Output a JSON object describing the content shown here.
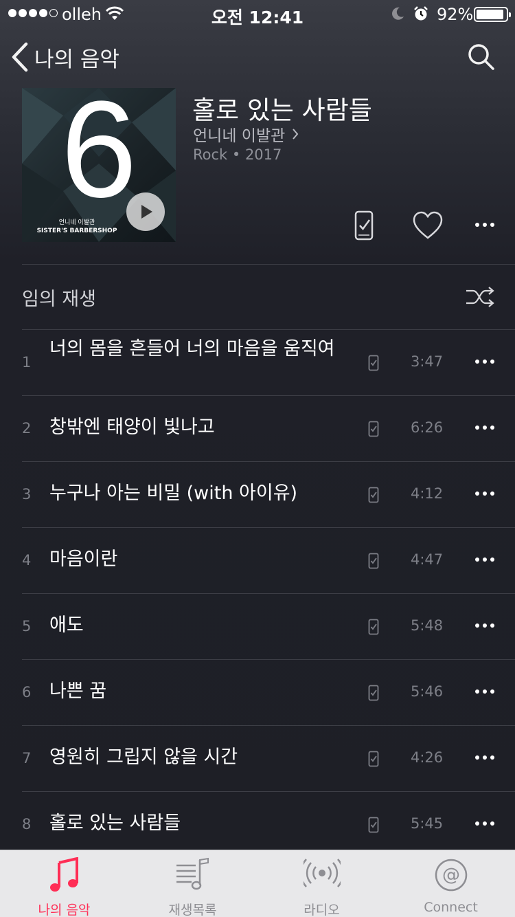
{
  "status": {
    "carrier": "olleh",
    "time": "오전 12:41",
    "battery": "92%",
    "battery_level": 0.92
  },
  "nav": {
    "back_label": "나의 음악"
  },
  "album": {
    "title": "홀로 있는 사람들",
    "artist": "언니네 이발관",
    "meta": "Rock • 2017",
    "art_number": "6",
    "art_artist": "언니네 이발관",
    "art_subtitle": "SISTER'S BARBERSHOP"
  },
  "shuffle": {
    "label": "임의 재생"
  },
  "tracks": [
    {
      "num": "1",
      "title": "너의 몸을 흔들어 너의 마음을 움직여",
      "time": "3:47"
    },
    {
      "num": "2",
      "title": "창밖엔 태양이 빛나고",
      "time": "6:26"
    },
    {
      "num": "3",
      "title": "누구나 아는 비밀 (with 아이유)",
      "time": "4:12"
    },
    {
      "num": "4",
      "title": "마음이란",
      "time": "4:47"
    },
    {
      "num": "5",
      "title": "애도",
      "time": "5:48"
    },
    {
      "num": "6",
      "title": "나쁜 꿈",
      "time": "5:46"
    },
    {
      "num": "7",
      "title": "영원히 그립지 않을 시간",
      "time": "4:26"
    },
    {
      "num": "8",
      "title": "홀로 있는 사람들",
      "time": "5:45"
    }
  ],
  "tabs": [
    {
      "label": "나의 음악",
      "icon": "music-note-icon",
      "active": true
    },
    {
      "label": "재생목록",
      "icon": "playlist-icon",
      "active": false
    },
    {
      "label": "라디오",
      "icon": "radio-icon",
      "active": false
    },
    {
      "label": "Connect",
      "icon": "connect-icon",
      "active": false
    }
  ],
  "colors": {
    "accent": "#ff2d55",
    "background": "#1e1f26",
    "secondary_text": "#7d7f87"
  }
}
